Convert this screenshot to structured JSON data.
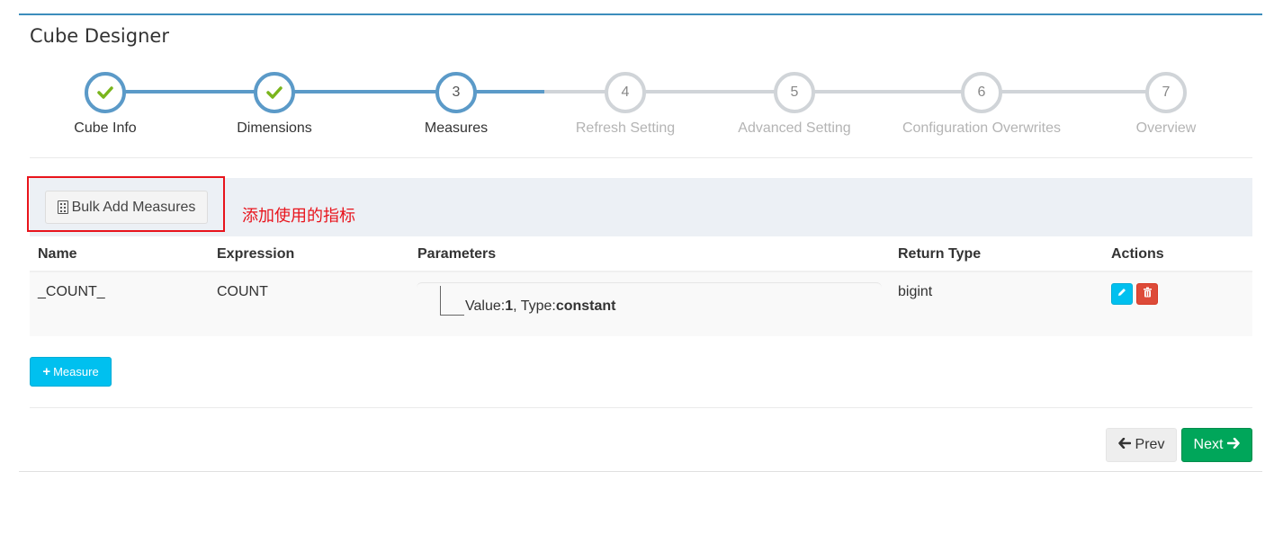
{
  "panel": {
    "title": "Cube Designer"
  },
  "wizard": {
    "steps": [
      {
        "number": "1",
        "label": "Cube Info",
        "state": "done"
      },
      {
        "number": "2",
        "label": "Dimensions",
        "state": "done"
      },
      {
        "number": "3",
        "label": "Measures",
        "state": "active"
      },
      {
        "number": "4",
        "label": "Refresh Setting",
        "state": "pending"
      },
      {
        "number": "5",
        "label": "Advanced Setting",
        "state": "pending"
      },
      {
        "number": "6",
        "label": "Configuration Overwrites",
        "state": "pending"
      },
      {
        "number": "7",
        "label": "Overview",
        "state": "pending"
      }
    ],
    "colors": {
      "done": "#5b9ac8",
      "pending": "#d0d4d8",
      "check": "#7ab51d"
    }
  },
  "toolbar": {
    "bulk_add_label": "Bulk Add Measures",
    "annotation": "添加使用的指标"
  },
  "table": {
    "headers": {
      "name": "Name",
      "expression": "Expression",
      "parameters": "Parameters",
      "return_type": "Return Type",
      "actions": "Actions"
    },
    "rows": [
      {
        "name": "_COUNT_",
        "expression": "COUNT",
        "param_value_label": "Value:",
        "param_value": "1",
        "param_type_label": ", Type:",
        "param_type": "constant",
        "return_type": "bigint"
      }
    ]
  },
  "buttons": {
    "add_measure": "Measure",
    "prev": "Prev",
    "next": "Next"
  }
}
